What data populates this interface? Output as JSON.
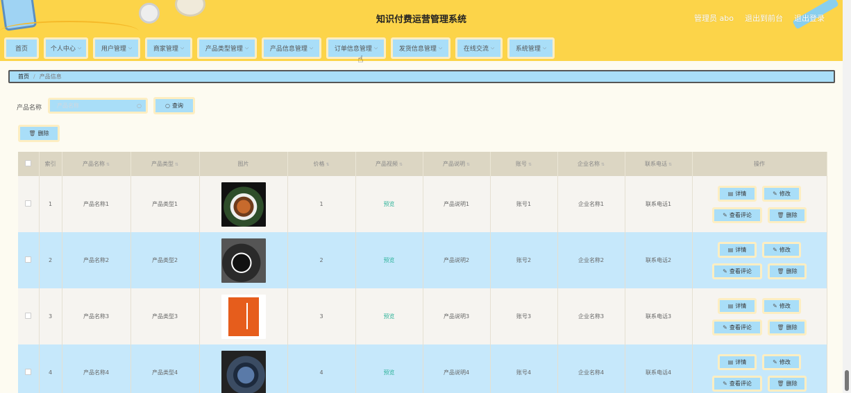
{
  "header": {
    "title": "知识付费运营管理系统",
    "user_label": "管理员 abo",
    "back_label": "退出到前台",
    "logout_label": "退出登录"
  },
  "nav": {
    "items": [
      {
        "label": "首页",
        "has_dropdown": false
      },
      {
        "label": "个人中心",
        "has_dropdown": true
      },
      {
        "label": "用户管理",
        "has_dropdown": true
      },
      {
        "label": "商家管理",
        "has_dropdown": true
      },
      {
        "label": "产品类型管理",
        "has_dropdown": true
      },
      {
        "label": "产品信息管理",
        "has_dropdown": true
      },
      {
        "label": "订单信息管理",
        "has_dropdown": true
      },
      {
        "label": "发货信息管理",
        "has_dropdown": true
      },
      {
        "label": "在线交流",
        "has_dropdown": true
      },
      {
        "label": "系统管理",
        "has_dropdown": true
      }
    ]
  },
  "breadcrumb": {
    "home": "首页",
    "separator": "/",
    "current": "产品信息"
  },
  "search": {
    "label": "产品名称",
    "placeholder": "产品名称",
    "button_label": "查询"
  },
  "toolbar": {
    "delete_label": "删除"
  },
  "table": {
    "headers": [
      "索引",
      "产品名称",
      "产品类型",
      "图片",
      "价格",
      "产品视频",
      "产品说明",
      "账号",
      "企业名称",
      "联系电话",
      "操作"
    ],
    "rows": [
      {
        "index": "1",
        "name": "产品名称1",
        "type": "产品类型1",
        "image": "food-image",
        "price": "1",
        "video": "预览",
        "desc": "产品说明1",
        "account": "账号1",
        "company": "企业名称1",
        "phone": "联系电话1"
      },
      {
        "index": "2",
        "name": "产品名称2",
        "type": "产品类型2",
        "image": "shoes-image",
        "price": "2",
        "video": "预览",
        "desc": "产品说明2",
        "account": "账号2",
        "company": "企业名称2",
        "phone": "联系电话2"
      },
      {
        "index": "3",
        "name": "产品名称3",
        "type": "产品类型3",
        "image": "book-image",
        "price": "3",
        "video": "预览",
        "desc": "产品说明3",
        "account": "账号3",
        "company": "企业名称3",
        "phone": "联系电话3"
      },
      {
        "index": "4",
        "name": "产品名称4",
        "type": "产品类型4",
        "image": "watch-image",
        "price": "4",
        "video": "预览",
        "desc": "产品说明4",
        "account": "账号4",
        "company": "企业名称4",
        "phone": "联系电话4"
      }
    ],
    "actions": {
      "detail": "详情",
      "edit": "修改",
      "comments": "查看评论",
      "delete": "删除"
    }
  },
  "colors": {
    "header_bg": "#fcd449",
    "button_bg": "#a9def8",
    "button_border": "#fdeec2",
    "table_header_bg": "#dcd6c3",
    "row_even_bg": "#c6e8fb",
    "row_odd_bg": "#f6f4f0",
    "video_link": "#2fb39b"
  }
}
